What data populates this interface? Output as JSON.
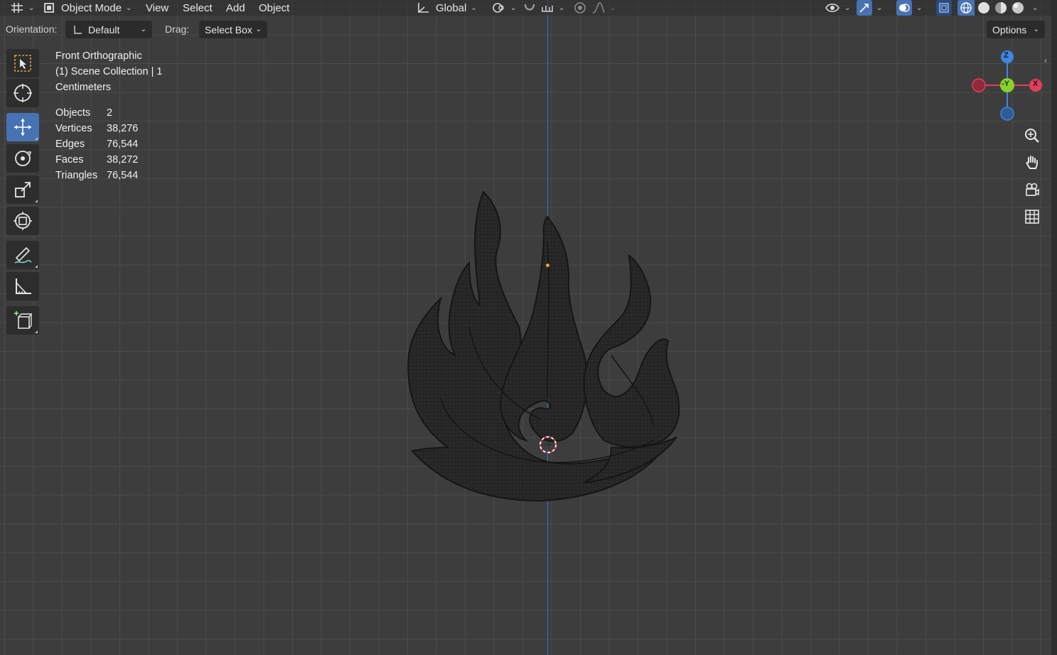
{
  "header": {
    "editor_type_icon": "editor-type-icon",
    "mode": "Object Mode",
    "menus": [
      "View",
      "Select",
      "Add",
      "Object"
    ],
    "transform_orientation": "Global",
    "pivot_icon": "pivot-icon",
    "snap_icon": "magnet-icon",
    "proportional_icon": "proportional-edit-icon",
    "visibility_icon": "eye-icon",
    "gizmo_icon": "gizmo-icon",
    "overlay_icon": "overlay-icon",
    "xray_icon": "xray-icon",
    "shading_icons": [
      "wireframe-icon",
      "solid-icon",
      "material-icon",
      "rendered-icon"
    ]
  },
  "toolsettings": {
    "orientation_label": "Orientation:",
    "orientation_value": "Default",
    "drag_label": "Drag:",
    "drag_value": "Select Box",
    "options_label": "Options"
  },
  "toolbar": {
    "tools": [
      "select-box-icon",
      "cursor-icon",
      "move-icon",
      "rotate-icon",
      "scale-icon",
      "transform-icon",
      "annotate-icon",
      "measure-icon",
      "add-cube-icon"
    ],
    "active_tool": "move-icon"
  },
  "overlay": {
    "view_name": "Front Orthographic",
    "collection": "(1) Scene Collection | 1",
    "units": "Centimeters"
  },
  "stats": [
    {
      "label": "Objects",
      "value": "2"
    },
    {
      "label": "Vertices",
      "value": "38,276"
    },
    {
      "label": "Edges",
      "value": "76,544"
    },
    {
      "label": "Faces",
      "value": "38,272"
    },
    {
      "label": "Triangles",
      "value": "76,544"
    }
  ],
  "gizmo": {
    "z_label": "Z",
    "y_label": "-Y",
    "x_label": "X",
    "colors": {
      "x": "#e0405a",
      "y": "#8ad12b",
      "z": "#3f86e0"
    }
  },
  "nav": [
    "zoom-icon",
    "pan-hand-icon",
    "camera-icon",
    "grid-ortho-icon"
  ],
  "colors": {
    "accent": "#4772b3",
    "background": "#3d3d3d",
    "mesh": "#1e1e1e"
  }
}
